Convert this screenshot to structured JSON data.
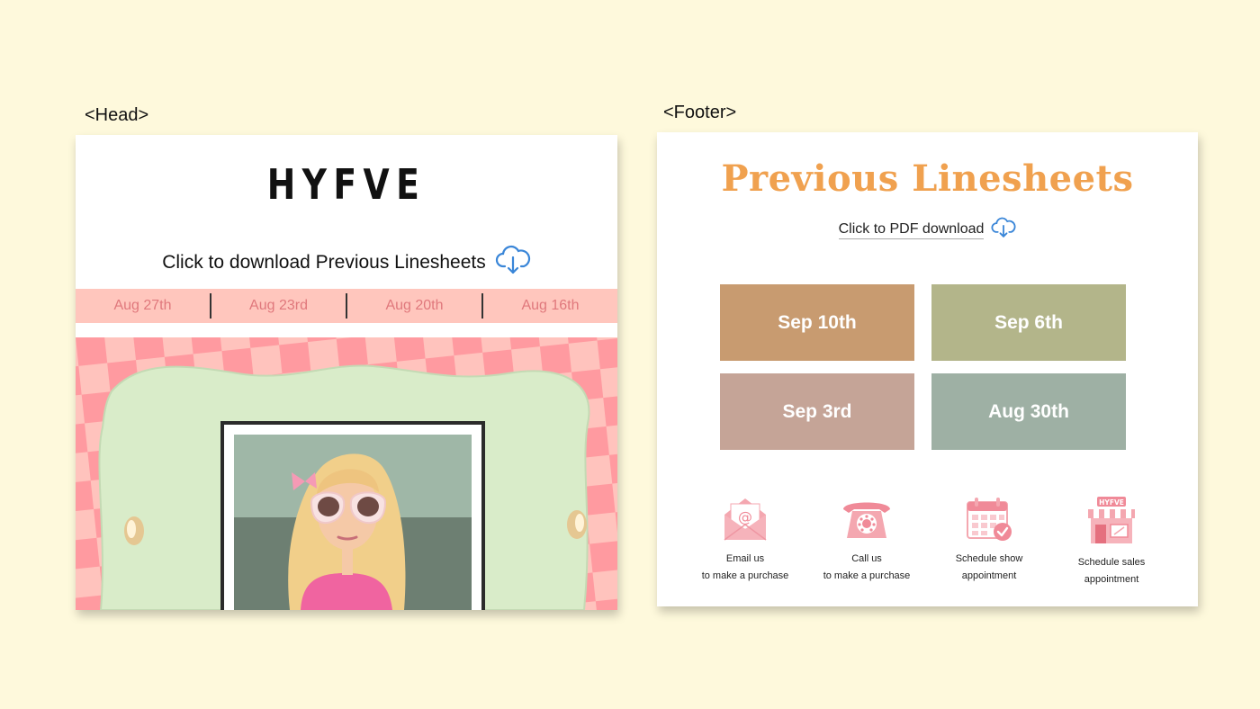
{
  "labels": {
    "head": "<Head>",
    "footer": "<Footer>"
  },
  "head": {
    "brand": "HYFVE",
    "download_text": "Click to download Previous Linesheets",
    "dates": [
      "Aug 27th",
      "Aug 23rd",
      "Aug 20th",
      "Aug 16th"
    ]
  },
  "footer": {
    "title": "Previous Linesheets",
    "download_text": "Click to PDF download",
    "tiles": [
      {
        "label": "Sep 10th",
        "color": "#c89b70"
      },
      {
        "label": "Sep 6th",
        "color": "#b3b58a"
      },
      {
        "label": "Sep 3rd",
        "color": "#c5a497"
      },
      {
        "label": "Aug 30th",
        "color": "#9eb0a4"
      }
    ],
    "contacts": [
      {
        "line1": "Email us",
        "line2": "to make a purchase",
        "icon": "envelope-icon"
      },
      {
        "line1": "Call us",
        "line2": "to make a purchase",
        "icon": "phone-icon"
      },
      {
        "line1": "Schedule show",
        "line2": "appointment",
        "icon": "calendar-icon"
      },
      {
        "line1": "Schedule sales",
        "line2": "appointment",
        "icon": "storefront-icon",
        "badge": "HYFVE"
      }
    ]
  },
  "colors": {
    "page_background": "#fef9dc",
    "date_bar": "#ffc6bd",
    "date_text": "#e0787c",
    "title_orange": "#f0a14f",
    "cloud_blue": "#3a86d8",
    "icon_pink": "#f2a0aa"
  }
}
